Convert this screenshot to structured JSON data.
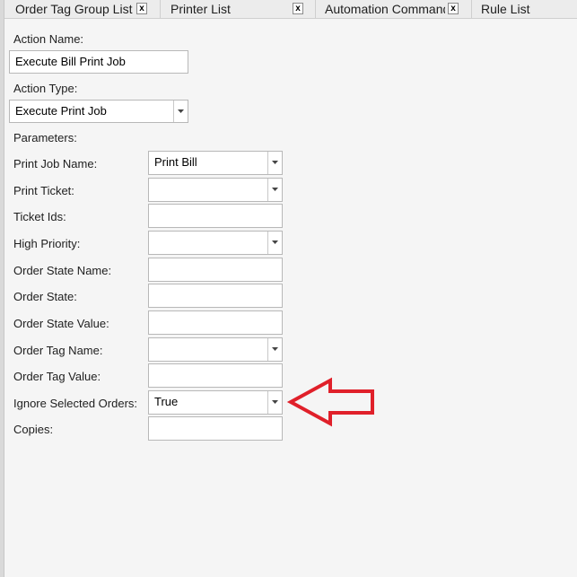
{
  "tabs": [
    {
      "label": "Order Tag Group List",
      "close": "x"
    },
    {
      "label": "Printer List",
      "close": "x"
    },
    {
      "label": "Automation Command List",
      "close": "x"
    },
    {
      "label": "Rule List"
    }
  ],
  "form": {
    "action_name_label": "Action Name:",
    "action_name_value": "Execute Bill Print Job",
    "action_type_label": "Action Type:",
    "action_type_value": "Execute Print Job",
    "parameters_label": "Parameters:",
    "params": [
      {
        "label": "Print Job Name:",
        "value": "Print Bill"
      },
      {
        "label": "Print Ticket:",
        "value": ""
      },
      {
        "label": "Ticket Ids:",
        "value": ""
      },
      {
        "label": "High Priority:",
        "value": ""
      },
      {
        "label": "Order State Name:",
        "value": ""
      },
      {
        "label": "Order State:",
        "value": ""
      },
      {
        "label": "Order State Value:",
        "value": ""
      },
      {
        "label": "Order Tag Name:",
        "value": ""
      },
      {
        "label": "Order Tag Value:",
        "value": ""
      },
      {
        "label": "Ignore Selected Orders:",
        "value": "True"
      },
      {
        "label": "Copies:",
        "value": ""
      }
    ]
  },
  "annotation": {
    "arrow_color": "#e0202a",
    "icon": "left-arrow-icon"
  },
  "colors": {
    "background": "#f5f5f5",
    "field_border": "#b8b8b8"
  }
}
